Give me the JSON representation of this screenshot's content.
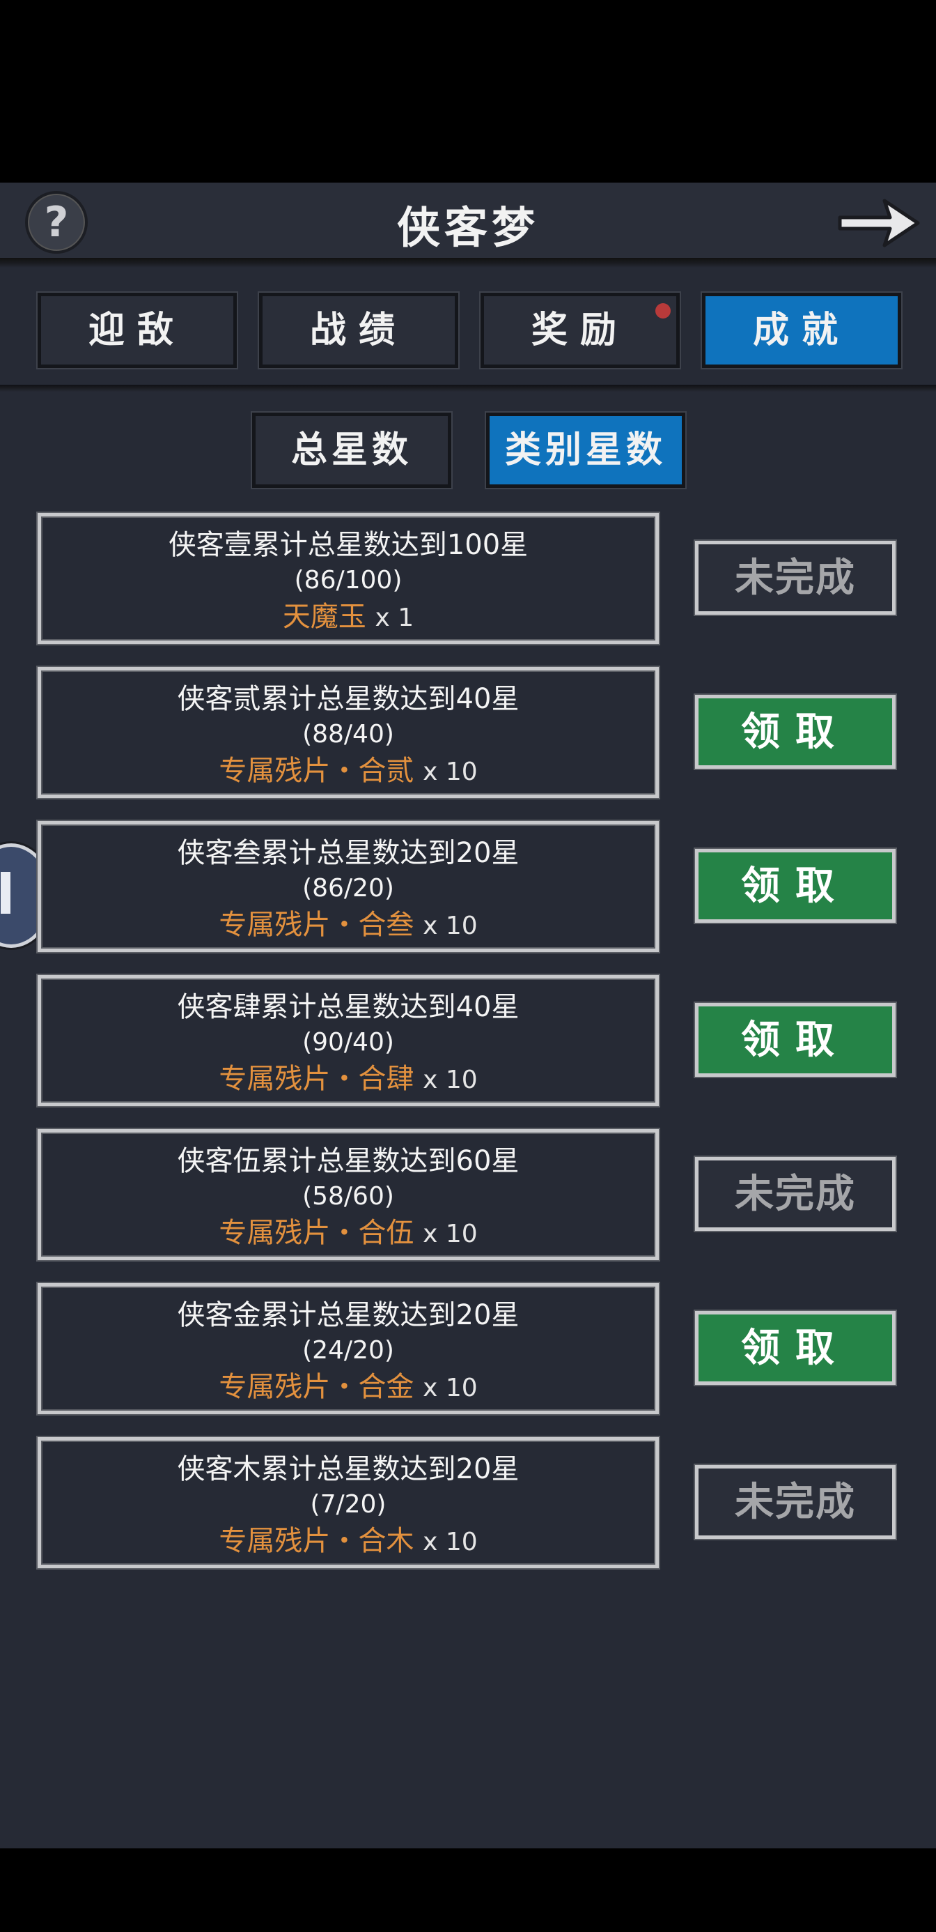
{
  "header": {
    "title": "侠客梦",
    "help_icon": "question-mark-icon",
    "back_icon": "arrow-right-icon"
  },
  "tabs": [
    {
      "label": "迎敌",
      "active": false,
      "badge": false
    },
    {
      "label": "战绩",
      "active": false,
      "badge": false
    },
    {
      "label": "奖励",
      "active": false,
      "badge": true
    },
    {
      "label": "成就",
      "active": true,
      "badge": false
    }
  ],
  "subtabs": [
    {
      "label": "总星数",
      "active": false
    },
    {
      "label": "类别星数",
      "active": true
    }
  ],
  "achievements": [
    {
      "title": "侠客壹累计总星数达到100星",
      "progress": "(86/100)",
      "reward": "天魔玉",
      "count": "x 1",
      "status": "未完成",
      "claimable": false
    },
    {
      "title": "侠客贰累计总星数达到40星",
      "progress": "(88/40)",
      "reward": "专属残片・合贰",
      "count": "x 10",
      "status": "领取",
      "claimable": true
    },
    {
      "title": "侠客叁累计总星数达到20星",
      "progress": "(86/20)",
      "reward": "专属残片・合叁",
      "count": "x 10",
      "status": "领取",
      "claimable": true
    },
    {
      "title": "侠客肆累计总星数达到40星",
      "progress": "(90/40)",
      "reward": "专属残片・合肆",
      "count": "x 10",
      "status": "领取",
      "claimable": true
    },
    {
      "title": "侠客伍累计总星数达到60星",
      "progress": "(58/60)",
      "reward": "专属残片・合伍",
      "count": "x 10",
      "status": "未完成",
      "claimable": false
    },
    {
      "title": "侠客金累计总星数达到20星",
      "progress": "(24/20)",
      "reward": "专属残片・合金",
      "count": "x 10",
      "status": "领取",
      "claimable": true
    },
    {
      "title": "侠客木累计总星数达到20星",
      "progress": "(7/20)",
      "reward": "专属残片・合木",
      "count": "x 10",
      "status": "未完成",
      "claimable": false
    }
  ],
  "colors": {
    "accent": "#0f73bd",
    "claim": "#258347",
    "reward": "#e3913e",
    "background": "#262a35",
    "notify_dot": "#b83a3a"
  }
}
